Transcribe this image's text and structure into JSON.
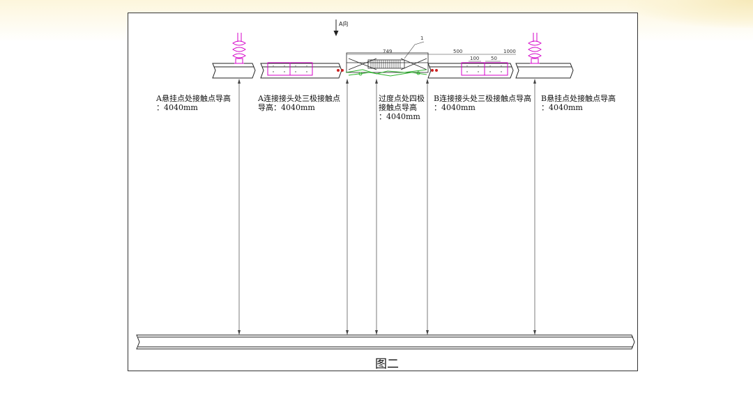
{
  "direction_label": "A向",
  "callout_number": "1",
  "dimensions": {
    "center_span": "749",
    "right_500": "500",
    "right_1000": "1000",
    "right_100": "100",
    "right_50": "50"
  },
  "labels": [
    {
      "id": "a-suspension",
      "line1": "A悬挂点处接触点导高",
      "line2": "：4040mm"
    },
    {
      "id": "a-joint",
      "line1": "A连接接头处三极接触点",
      "line2": "导高：4040mm"
    },
    {
      "id": "transition",
      "line1": "过度点处四极",
      "line2": "接触点导高",
      "line3": "：4040mm"
    },
    {
      "id": "b-joint",
      "line1": "B连接接头处三极接触点导高",
      "line2": "：4040mm"
    },
    {
      "id": "b-suspension",
      "line1": "B悬挂点处接触点导高",
      "line2": "：4040mm"
    }
  ],
  "caption": "图二",
  "colors": {
    "magenta": "#d400c8",
    "green": "#2bb32b",
    "red": "#cc2222",
    "line": "#222222"
  }
}
